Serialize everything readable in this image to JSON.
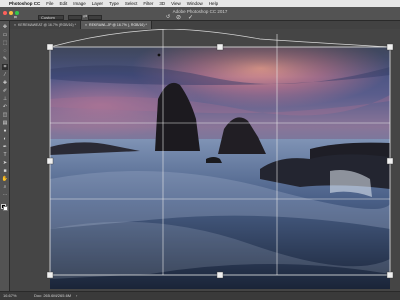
{
  "menubar": {
    "apple": "",
    "app": "Photoshop CC",
    "items": [
      "File",
      "Edit",
      "Image",
      "Layer",
      "Type",
      "Select",
      "Filter",
      "3D",
      "View",
      "Window",
      "Help"
    ]
  },
  "optionsbar": {
    "document_title": "Adobe Photoshop CC 2017",
    "ratio": "Custom",
    "traffic_colors": [
      "#fc605c",
      "#fdbc40",
      "#34c84a"
    ]
  },
  "tabs": [
    {
      "label": "KEREMAWEAT @ 16.7% (RGB/16) *",
      "close": "×",
      "active": false
    },
    {
      "label": "REKRAWL-JP @ 16.7% (, RGB/16) *",
      "close": "×",
      "active": true
    }
  ],
  "toolbar": {
    "tools": [
      "move-tool",
      "artboard-tool",
      "marquee-tool",
      "lasso-tool",
      "quick-select-tool",
      "crop-tool",
      "eyedropper-tool",
      "healing-tool",
      "brush-tool",
      "clone-stamp-tool",
      "history-brush-tool",
      "eraser-tool",
      "gradient-tool",
      "blur-tool",
      "dodge-tool",
      "pen-tool",
      "type-tool",
      "path-select-tool",
      "shape-tool",
      "hand-tool",
      "zoom-tool",
      "more-tools"
    ],
    "active_tool": "crop-tool"
  },
  "statusbar": {
    "zoom": "16.67%",
    "info": "Doc: 265.6M/265.6M",
    "arrow": "›"
  }
}
